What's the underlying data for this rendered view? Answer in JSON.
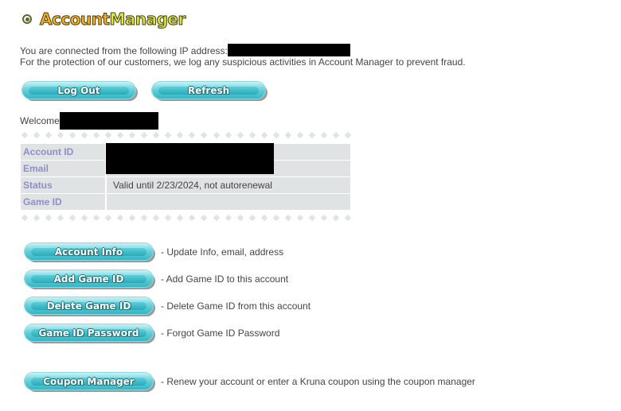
{
  "header": {
    "title_part1": "Account",
    "title_part2": "Manager"
  },
  "info": {
    "ip_line": "You are connected from the following IP address:",
    "fraud_line": "For the protection of our customers, we log any suspicious activities in Account Manager to prevent fraud."
  },
  "buttons": {
    "logout": "Log Out",
    "refresh": "Refresh"
  },
  "welcome": {
    "label": "Welcome"
  },
  "account_table": {
    "rows": [
      {
        "label": "Account ID",
        "value": ""
      },
      {
        "label": "Email",
        "value": ""
      },
      {
        "label": "Status",
        "value": "Valid until 2/23/2024, not autorenewal"
      },
      {
        "label": "Game ID",
        "value": ""
      }
    ]
  },
  "actions": [
    {
      "label": "Account Info",
      "description": "- Update Info, email, address"
    },
    {
      "label": "Add Game ID",
      "description": "- Add Game ID to this account"
    },
    {
      "label": "Delete Game ID",
      "description": "- Delete Game ID from this account"
    },
    {
      "label": "Game ID Password",
      "description": "- Forgot Game ID Password"
    },
    {
      "label": "Coupon Manager",
      "description": "- Renew your account or enter a Kruna coupon using the coupon manager"
    }
  ],
  "colors": {
    "title_orange": "#f3b21f",
    "title_lime": "#d6ea46",
    "button_teal": "#33b5c4",
    "table_bg": "#dfe3e3",
    "label_purple": "#8e8ec8"
  }
}
